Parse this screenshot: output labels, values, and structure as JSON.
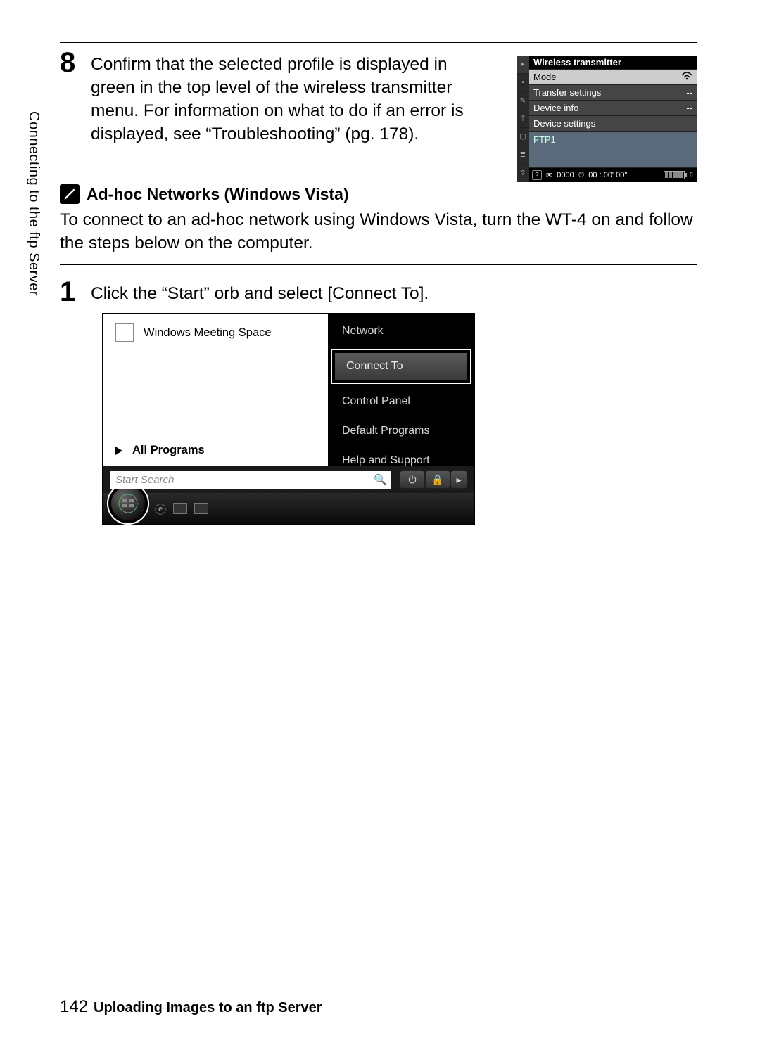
{
  "sidetab": "Connecting to the ftp Server",
  "step8": {
    "num": "8",
    "text": "Confirm that the selected profile is displayed in green in the top level of the wireless transmitter menu.  For information on what to do if an error is displayed, see “Troubleshooting” (pg. 178)."
  },
  "camera": {
    "title": "Wireless transmitter",
    "rows": [
      {
        "label": "Mode",
        "val": "",
        "sel": true,
        "wifi": true
      },
      {
        "label": "Transfer settings",
        "val": "--"
      },
      {
        "label": "Device info",
        "val": "--"
      },
      {
        "label": "Device settings",
        "val": "--"
      }
    ],
    "profile": "FTP1",
    "status_count": "0000",
    "status_time": "00 : 00' 00\""
  },
  "note": {
    "heading": "Ad-hoc Networks (Windows Vista)",
    "body": "To connect to an ad-hoc network using Windows Vista, turn the WT-4 on and follow the steps below on the computer."
  },
  "step1": {
    "num": "1",
    "text": "Click the “Start” orb and select [Connect To]."
  },
  "vista": {
    "left_item": "Windows Meeting Space",
    "all_programs": "All Programs",
    "right_items": {
      "network": "Network",
      "connect_to": "Connect To",
      "control_panel": "Control Panel",
      "default_programs": "Default Programs",
      "help": "Help and Support"
    },
    "search_placeholder": "Start Search"
  },
  "footer": {
    "page": "142",
    "title": "Uploading Images to an ftp Server"
  }
}
